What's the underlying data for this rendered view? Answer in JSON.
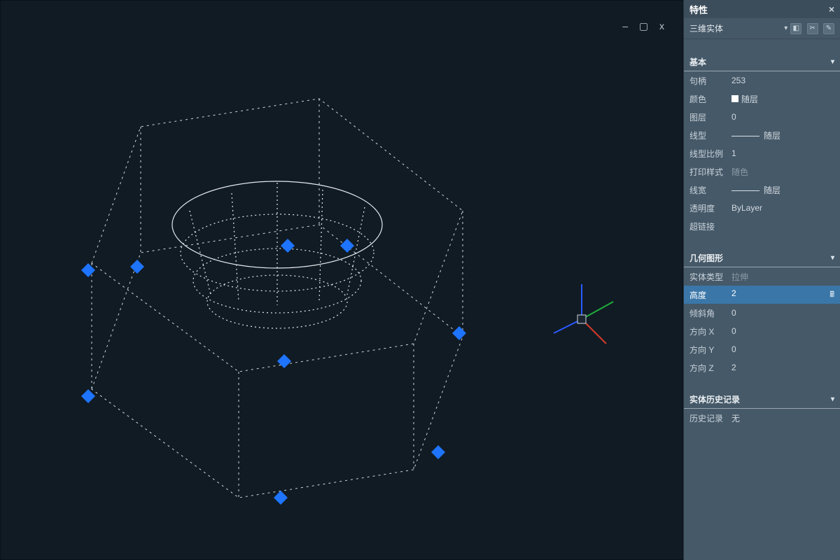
{
  "panel": {
    "title": "特性",
    "objectType": "三维实体",
    "sections": {
      "basic": {
        "title": "基本",
        "rows": {
          "handle": {
            "k": "句柄",
            "v": "253"
          },
          "color": {
            "k": "颜色",
            "v": "随层"
          },
          "layer": {
            "k": "图层",
            "v": "0"
          },
          "linetype": {
            "k": "线型",
            "v": "随层"
          },
          "ltscale": {
            "k": "线型比例",
            "v": "1"
          },
          "pstyle": {
            "k": "打印样式",
            "v": "随色"
          },
          "lweight": {
            "k": "线宽",
            "v": "随层"
          },
          "transp": {
            "k": "透明度",
            "v": "ByLayer"
          },
          "hyper": {
            "k": "超链接",
            "v": ""
          }
        }
      },
      "geometry": {
        "title": "几何图形",
        "rows": {
          "stype": {
            "k": "实体类型",
            "v": "拉伸"
          },
          "height": {
            "k": "高度",
            "v": "2"
          },
          "taper": {
            "k": "倾斜角",
            "v": "0"
          },
          "dirx": {
            "k": "方向 X",
            "v": "0"
          },
          "diry": {
            "k": "方向 Y",
            "v": "0"
          },
          "dirz": {
            "k": "方向 Z",
            "v": "2"
          }
        }
      },
      "history": {
        "title": "实体历史记录",
        "rows": {
          "hist": {
            "k": "历史记录",
            "v": "无"
          }
        }
      }
    }
  },
  "winControls": {
    "min": "–",
    "sq": "▢",
    "x": "x"
  }
}
